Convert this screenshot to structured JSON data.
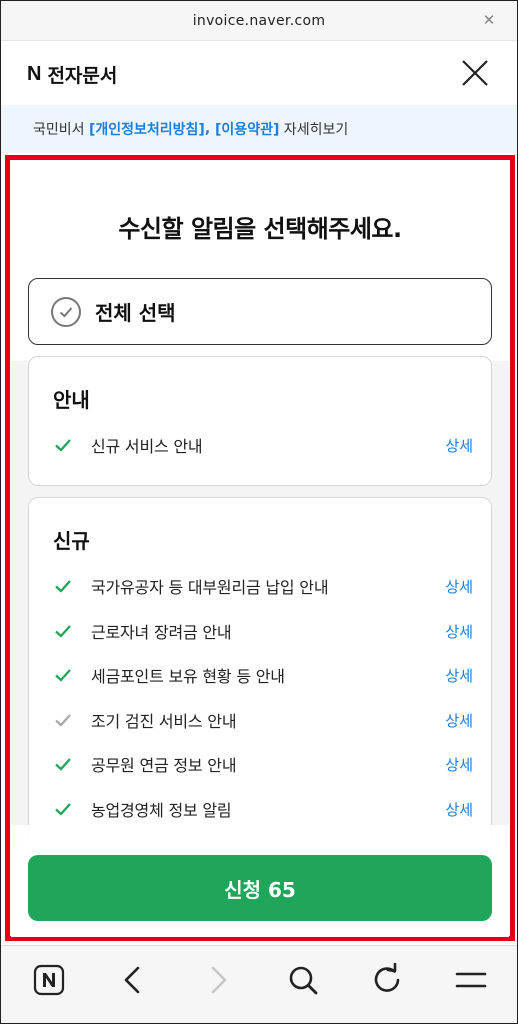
{
  "browser": {
    "url": "invoice.naver.com"
  },
  "header": {
    "logo_mark": "N",
    "title": "전자문서"
  },
  "notice": {
    "prefix": "국민비서 ",
    "privacy_link": "[개인정보처리방침]",
    "separator": ", ",
    "terms_link": "[이용약관]",
    "suffix": " 자세히보기"
  },
  "panel": {
    "title": "수신할 알림을 선택해주세요.",
    "select_all_label": "전체 선택",
    "sections": [
      {
        "title": "안내",
        "items": [
          {
            "label": "신규 서비스 안내",
            "detail": "상세",
            "checked": true
          }
        ]
      },
      {
        "title": "신규",
        "items": [
          {
            "label": "국가유공자 등 대부원리금 납입 안내",
            "detail": "상세",
            "checked": true
          },
          {
            "label": "근로자녀 장려금 안내",
            "detail": "상세",
            "checked": true
          },
          {
            "label": "세금포인트 보유 현황 등 안내",
            "detail": "상세",
            "checked": true
          },
          {
            "label": "조기 검진 서비스 안내",
            "detail": "상세",
            "checked": false
          },
          {
            "label": "공무원 연금 정보 안내",
            "detail": "상세",
            "checked": true
          },
          {
            "label": "농업경영체 정보 알림",
            "detail": "상세",
            "checked": true
          }
        ]
      }
    ],
    "apply_button": "신청 65"
  },
  "colors": {
    "accent_green": "#1fa65b",
    "link_blue": "#1a7fe0",
    "highlight_red": "#e4000f"
  }
}
